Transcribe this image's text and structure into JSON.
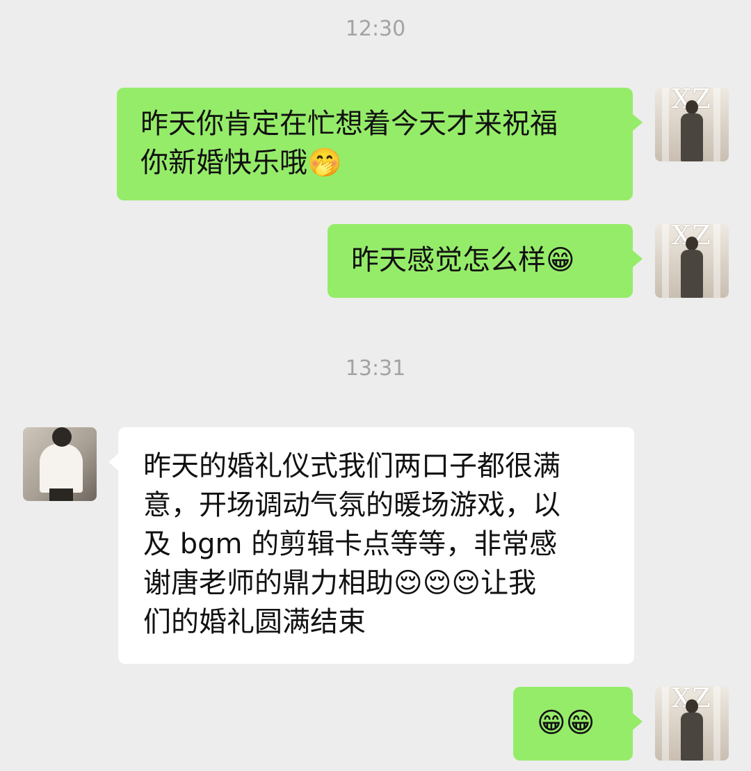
{
  "colors": {
    "background": "#ededed",
    "self_bubble": "#95ec69",
    "other_bubble": "#ffffff",
    "timestamp": "#a3a3a3"
  },
  "timestamps": [
    "12:30",
    "13:31"
  ],
  "avatars": {
    "self_text": "XZ",
    "self_description": "groom-photo-avatar",
    "other_description": "person-photo-avatar"
  },
  "messages": [
    {
      "sender": "self",
      "text": "昨天你肯定在忙想着今天才来祝福\n你新婚快乐哦🤭"
    },
    {
      "sender": "self",
      "text": "昨天感觉怎么样😁"
    },
    {
      "sender": "other",
      "text": "昨天的婚礼仪式我们两口子都很满\n意，开场调动气氛的暖场游戏，以\n及 bgm 的剪辑卡点等等，非常感\n谢唐老师的鼎力相助😌😌😌让我\n们的婚礼圆满结束"
    },
    {
      "sender": "self",
      "text": "😁😁"
    }
  ]
}
